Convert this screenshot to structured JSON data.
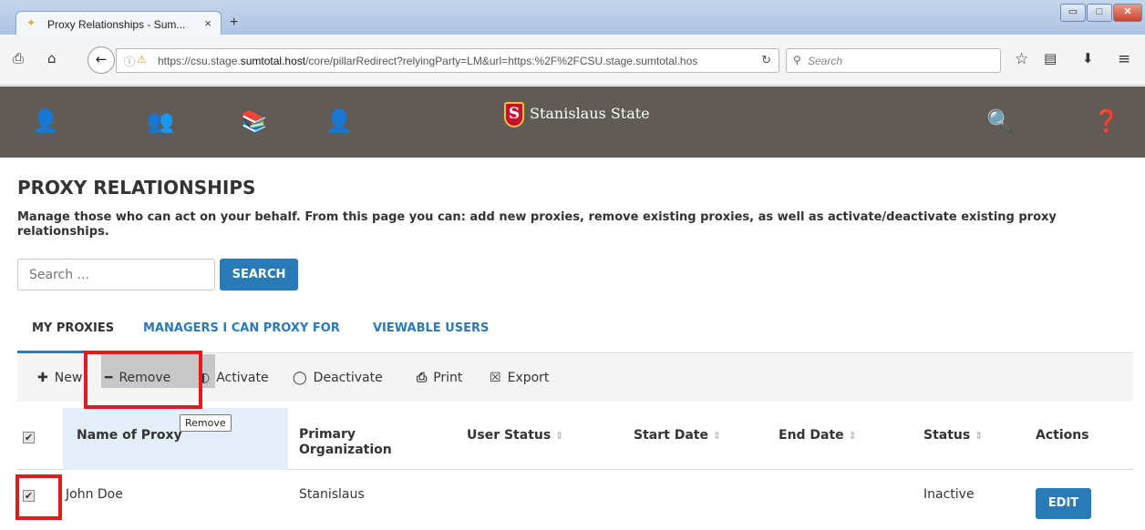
{
  "browser": {
    "tab_title": "Proxy Relationships - Sum...",
    "tab_close": "×",
    "new_tab": "+",
    "window_min": "▭",
    "window_max": "□",
    "window_close": "✕",
    "url_prefix": "https://csu.stage.",
    "url_domain": "sumtotal.host",
    "url_suffix": "/core/pillarRedirect?relyingParty=LM&url=https:%2F%2FCSU.stage.sumtotal.hos",
    "search_placeholder": "Search"
  },
  "header": {
    "logo_letter": "S",
    "logo_text": "Stanislaus State"
  },
  "page": {
    "title": "PROXY RELATIONSHIPS",
    "description": "Manage those who can act on your behalf. From this page you can: add new proxies, remove existing proxies, as well as activate/deactivate existing proxy relationships.",
    "search_placeholder": "Search ...",
    "search_button": "SEARCH"
  },
  "tabs": [
    {
      "label": "MY PROXIES",
      "active": true
    },
    {
      "label": "MANAGERS I CAN PROXY FOR",
      "active": false
    },
    {
      "label": "VIEWABLE USERS",
      "active": false
    }
  ],
  "toolbar": {
    "new": "New",
    "remove": "Remove",
    "activate": "Activate",
    "deactivate": "Deactivate",
    "print": "Print",
    "export": "Export"
  },
  "table": {
    "columns": {
      "name": "Name of Proxy",
      "org_line1": "Primary",
      "org_line2": "Organization",
      "user_status": "User Status",
      "start_date": "Start Date",
      "end_date": "End Date",
      "status": "Status",
      "actions": "Actions"
    },
    "tooltip": "Remove",
    "rows": [
      {
        "name": "John Doe",
        "organization": "Stanislaus",
        "user_status": "",
        "start_date": "",
        "end_date": "",
        "status": "Inactive",
        "action": "EDIT",
        "checked": true
      }
    ]
  },
  "colors": {
    "accent": "#2a7ab8",
    "header_bg": "#605b55",
    "highlight": "#e01b1b"
  }
}
